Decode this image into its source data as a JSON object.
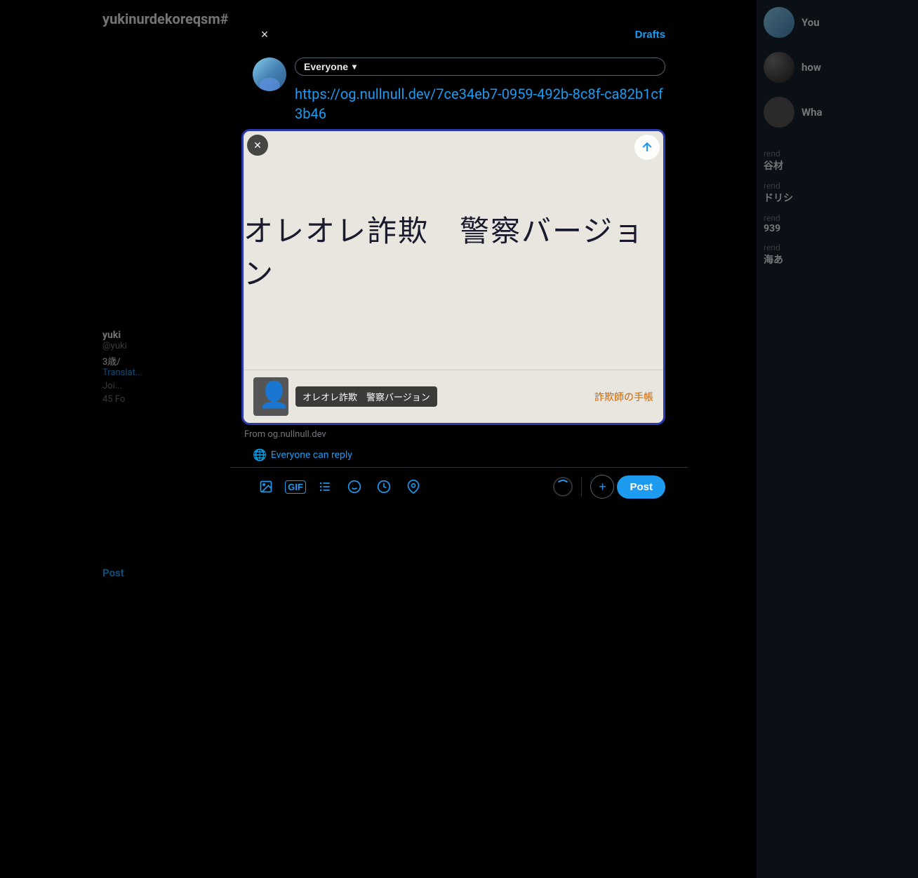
{
  "background": {
    "username": "yukinurdekoreqsm#",
    "left_profile": {
      "name": "yuki",
      "handle": "@yuki",
      "bio_age": "3歳/",
      "link": "Translat...",
      "join_label": "Joi...",
      "followers": "45 Fo"
    },
    "post_label": "Post",
    "right_items": [
      {
        "label": "You",
        "sublabel": ""
      },
      {
        "label": "how",
        "sublabel": ""
      },
      {
        "label": "Wha",
        "sublabel": ""
      },
      {
        "label": "rend",
        "sublabel": "谷材"
      },
      {
        "label": "rend",
        "sublabel": "ドリシ"
      },
      {
        "label": "rend",
        "sublabel": "939"
      },
      {
        "label": "rend",
        "sublabel": "海あ"
      }
    ]
  },
  "modal": {
    "close_label": "×",
    "drafts_label": "Drafts",
    "audience_label": "Everyone",
    "audience_chevron": "▾",
    "compose_url": "https://og.nullnull.dev/7ce34eb7-0959-492b-8c8f-ca82b1cf3b46",
    "link_card": {
      "main_text": "オレオレ詐欺　警察バージョン",
      "footer_title": "オレオレ詐欺　警察バージョン",
      "site_name": "詐欺師の手帳",
      "from_domain": "From og.nullnull.dev"
    },
    "reply_setting": "Everyone can reply",
    "toolbar": {
      "image_icon": "🖼",
      "gif_icon": "GIF",
      "list_icon": "≡",
      "emoji_icon": "☺",
      "schedule_icon": "🕐",
      "location_icon": "📍",
      "post_label": "Post",
      "add_label": "+"
    }
  }
}
